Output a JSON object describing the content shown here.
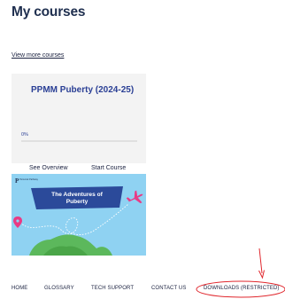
{
  "page": {
    "title": "My courses",
    "view_more": "View more courses"
  },
  "course": {
    "title": "PPMM Puberty (2024-25)",
    "progress_label": "0%",
    "progress_percent": 0,
    "overview_label": "See Overview",
    "start_label": "Start Course",
    "image": {
      "logo_text": "Personal Pathway",
      "banner_text_line1": "The Adventures of",
      "banner_text_line2": "Puberty"
    }
  },
  "footer_nav": {
    "items": [
      "HOME",
      "GLOSSARY",
      "TECH SUPPORT",
      "CONTACT US",
      "DOWNLOADS (RESTRICTED)"
    ]
  },
  "colors": {
    "title_text": "#1f2f4f",
    "course_title": "#2a3f95",
    "image_sky": "#8fd2f2",
    "banner": "#2b4a9a",
    "annotation": "#e0262c"
  }
}
